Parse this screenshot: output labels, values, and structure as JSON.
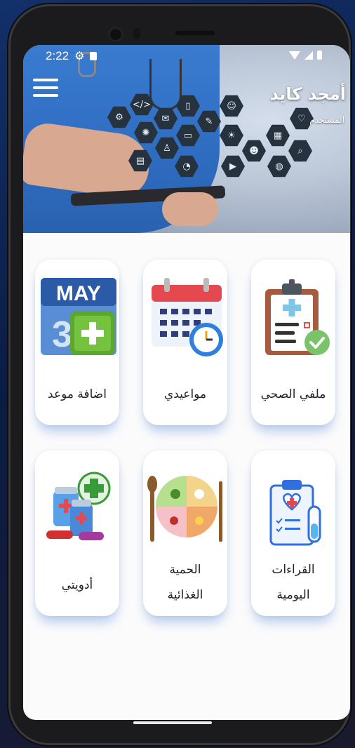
{
  "status_bar": {
    "time": "2:22"
  },
  "user": {
    "name": "أمجد كايد",
    "role": "المستخدم"
  },
  "cards": [
    {
      "label": "ملفي الصحي",
      "icon": "clipboard-health-icon"
    },
    {
      "label": "مواعيدي",
      "icon": "calendar-clock-icon"
    },
    {
      "label": "اضافة موعد",
      "icon": "calendar-add-icon",
      "icon_text": "MAY"
    },
    {
      "label_line1": "القراءات",
      "label_line2": "اليومية",
      "icon": "daily-readings-icon"
    },
    {
      "label_line1": "الحمية",
      "label_line2": "الغذائية",
      "icon": "diet-plate-icon"
    },
    {
      "label": "أدويتي",
      "icon": "medicines-icon"
    }
  ],
  "colors": {
    "card_shadow": "#78a0dc",
    "accent_blue": "#2e6cc0",
    "screen_bg": "#fbfbfc"
  }
}
